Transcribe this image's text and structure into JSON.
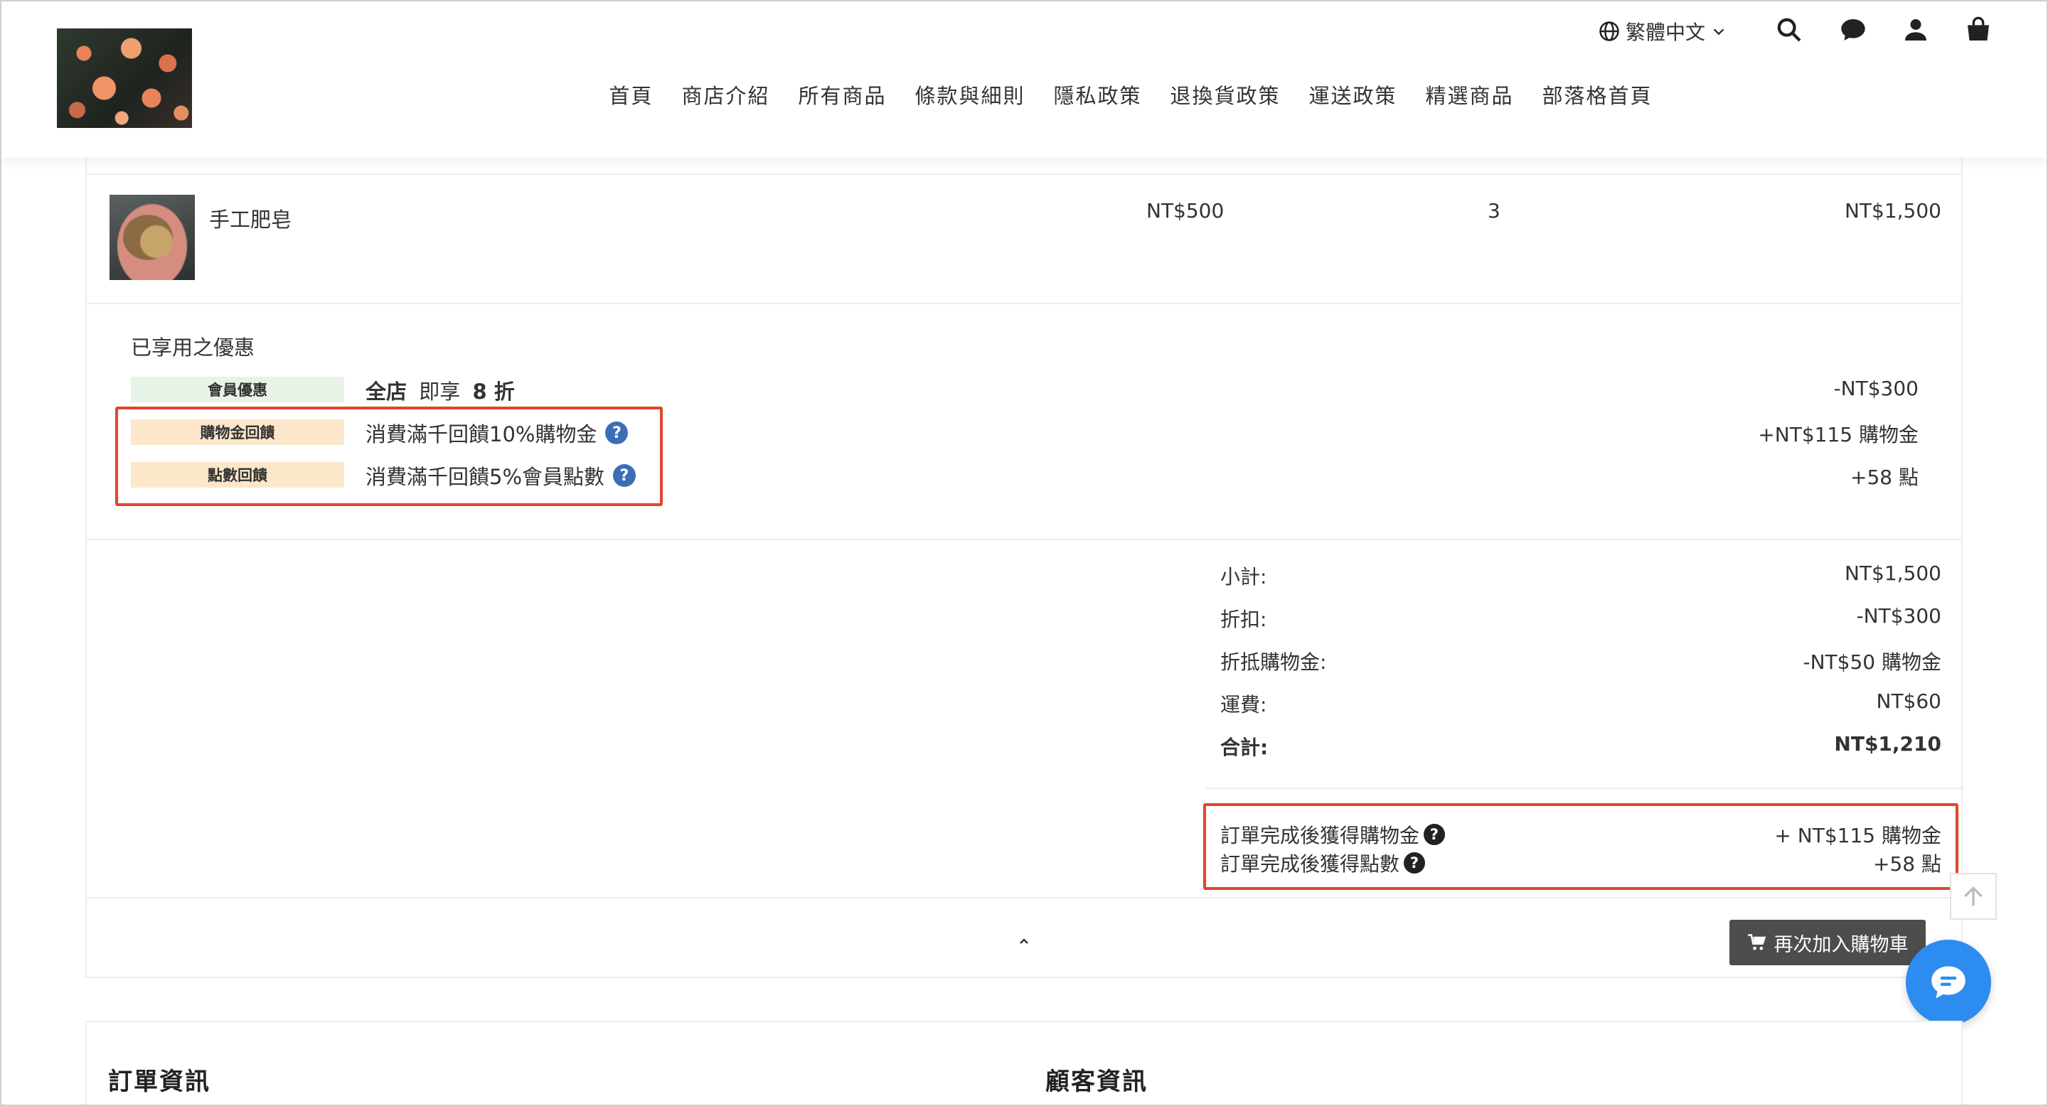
{
  "header": {
    "language": "繁體中文",
    "nav": [
      "首頁",
      "商店介紹",
      "所有商品",
      "條款與細則",
      "隱私政策",
      "退換貨政策",
      "運送政策",
      "精選商品",
      "部落格首頁"
    ]
  },
  "order_item": {
    "name": "手工肥皂",
    "price": "NT$500",
    "quantity": "3",
    "total": "NT$1,500"
  },
  "discounts": {
    "title": "已享用之優惠",
    "rows": [
      {
        "tag": "會員優惠",
        "desc_bold_1": "全店",
        "desc_mid": " 即享 ",
        "desc_bold_2": "8 折",
        "amount": "-NT$300",
        "tag_color": "#e7f3e6"
      },
      {
        "tag": "購物金回饋",
        "desc": "消費滿千回饋10%購物金",
        "amount": "+NT$115 購物金",
        "tag_color": "#fde7cb"
      },
      {
        "tag": "點數回饋",
        "desc": "消費滿千回饋5%會員點數",
        "amount": "+58 點",
        "tag_color": "#fde7cb"
      }
    ]
  },
  "summary": {
    "rows": [
      {
        "label": "小計:",
        "value": "NT$1,500"
      },
      {
        "label": "折扣:",
        "value": "-NT$300"
      },
      {
        "label": "折抵購物金:",
        "value": "-NT$50 購物金"
      },
      {
        "label": "運費:",
        "value": "NT$60"
      },
      {
        "label": "合計:",
        "value": "NT$1,210"
      }
    ],
    "earn": [
      {
        "label": "訂單完成後獲得購物金",
        "value": "+ NT$115 購物金"
      },
      {
        "label": "訂單完成後獲得點數",
        "value": "+58 點"
      }
    ]
  },
  "actions": {
    "readd_label": "再次加入購物車",
    "help_glyph": "?"
  },
  "info": {
    "order_info_title": "訂單資訊",
    "customer_info_title": "顧客資訊"
  },
  "colors": {
    "accent_blue": "#2d8cf0",
    "highlight_red": "#e0452f",
    "button_dark": "#4d4d4d"
  },
  "icons": [
    "globe-icon",
    "chevron-down-icon",
    "search-icon",
    "chat-bubble-icon",
    "user-icon",
    "shopping-bag-icon",
    "question-icon",
    "chevron-up-icon",
    "cart-icon",
    "arrow-up-icon",
    "chat-fab-icon"
  ]
}
